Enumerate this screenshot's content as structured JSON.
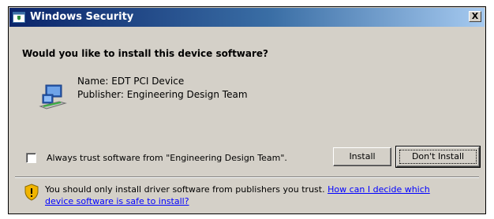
{
  "window": {
    "title": "Windows Security",
    "close_label": "X"
  },
  "dialog": {
    "question": "Would you like to install this device software?",
    "name": "Name: EDT PCI Device",
    "publisher": "Publisher: Engineering Design Team"
  },
  "trust": {
    "checkbox_label": "Always trust software from \"Engineering Design Team\".",
    "checked": false
  },
  "buttons": {
    "install": "Install",
    "dont_install": "Don't Install"
  },
  "warning": {
    "text": "You should only install driver software from publishers you trust.",
    "link_line1": "How can I decide which",
    "link_line2": "device software is safe to install?"
  },
  "icons": {
    "title": "shield-window-icon",
    "device": "network-device-icon",
    "warning": "security-shield-icon"
  },
  "colors": {
    "titlebar_start": "#0a246a",
    "titlebar_end": "#a6caf0",
    "dialog_face": "#d4d0c8",
    "link": "#0000ff"
  }
}
